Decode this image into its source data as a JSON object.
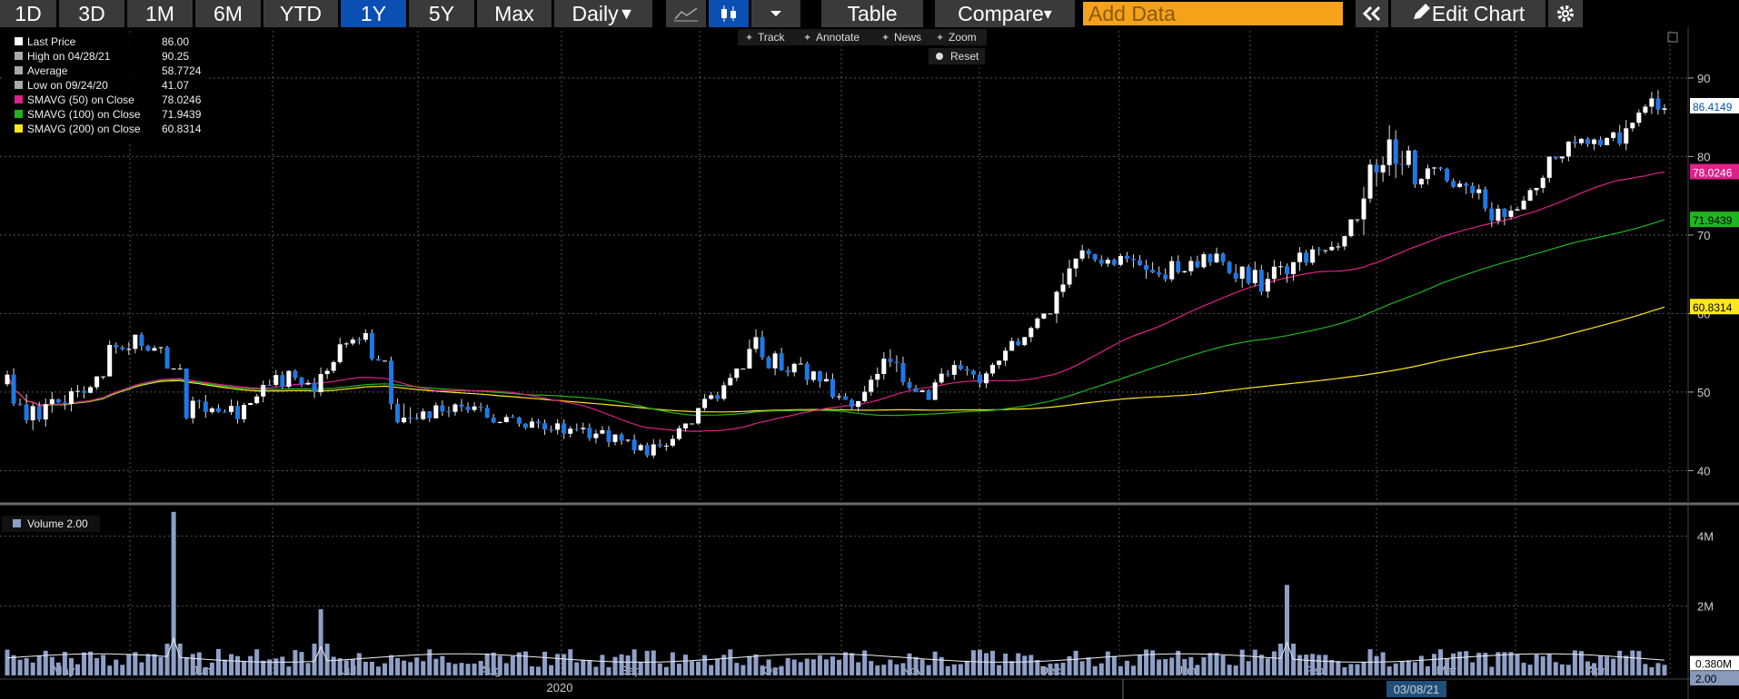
{
  "toolbar": {
    "ranges": [
      "1D",
      "3D",
      "1M",
      "6M",
      "YTD",
      "1Y",
      "5Y",
      "Max"
    ],
    "active_range": "1Y",
    "interval": "Daily",
    "table_label": "Table",
    "compare_label": "Compare",
    "add_data_placeholder": "Add Data",
    "edit_chart_label": "Edit Chart"
  },
  "chart_tools": {
    "track": "Track",
    "annotate": "Annotate",
    "news": "News",
    "zoom": "Zoom",
    "reset": "Reset"
  },
  "legend": [
    {
      "label": "Last Price",
      "value": "86.00",
      "color": "#ffffff"
    },
    {
      "label": "High on 04/28/21",
      "value": "90.25",
      "color": "#aaaaaa"
    },
    {
      "label": "Average",
      "value": "58.7724",
      "color": "#aaaaaa"
    },
    {
      "label": "Low on 09/24/20",
      "value": "41.07",
      "color": "#aaaaaa"
    },
    {
      "label": "SMAVG (50)  on Close",
      "value": "78.0246",
      "color": "#e0208a"
    },
    {
      "label": "SMAVG (100)  on Close",
      "value": "71.9439",
      "color": "#1fb51f"
    },
    {
      "label": "SMAVG (200)  on Close",
      "value": "60.8314",
      "color": "#ffe81a"
    }
  ],
  "volume_legend": "Volume 2.00",
  "price_tags": [
    {
      "value": "86.4149",
      "bg": "#ffffff",
      "fg": "#0055aa"
    },
    {
      "value": "78.0246",
      "bg": "#e0208a",
      "fg": "#ffffff"
    },
    {
      "value": "71.9439",
      "bg": "#1fb51f",
      "fg": "#000000"
    },
    {
      "value": "60.8314",
      "bg": "#ffe81a",
      "fg": "#000000"
    }
  ],
  "volume_tags": [
    {
      "value": "0.380M",
      "bg": "#ffffff",
      "fg": "#000000"
    },
    {
      "value": "2.00",
      "bg": "#8899bb",
      "fg": "#000000"
    }
  ],
  "crosshair_date": "03/08/21",
  "colors": {
    "up": "#ffffff",
    "down": "#1e78e6",
    "volume": "#8ea0c8",
    "grid": "#555555",
    "background": "#000000"
  },
  "chart_data": {
    "type": "candlestick",
    "interval": "Daily",
    "x_labels": [
      "May",
      "Jun",
      "Jul",
      "Aug",
      "Sep",
      "Oct",
      "Nov",
      "Dec",
      "Jan",
      "Feb",
      "Mar",
      "Apr"
    ],
    "year_label": "2020",
    "y_axis": {
      "ticks": [
        40,
        50,
        60,
        70,
        80,
        90
      ],
      "range": [
        36,
        96
      ]
    },
    "volume_axis": {
      "ticks": [
        "2M",
        "4M"
      ],
      "range": [
        0,
        4.8
      ]
    },
    "weekly_close": [
      51,
      47,
      50,
      49,
      55,
      57,
      55,
      48,
      49,
      47,
      51,
      52,
      51,
      56,
      57,
      48,
      47,
      48,
      48,
      47,
      46,
      46,
      45,
      45,
      44,
      42,
      44,
      48,
      51,
      56,
      54,
      53,
      51,
      48,
      53,
      52,
      50,
      53,
      51,
      55,
      58,
      63,
      68,
      67,
      66,
      65,
      66,
      67,
      66,
      64,
      66,
      68,
      69,
      76,
      80,
      78,
      78,
      76,
      73,
      73,
      78,
      81,
      82,
      82,
      86
    ],
    "weekly_high": [
      54,
      52,
      53,
      52,
      57,
      58,
      58,
      52,
      51,
      50,
      53,
      54,
      54,
      57,
      58,
      57,
      49,
      50,
      50,
      49,
      48,
      48,
      47,
      47,
      46,
      45,
      46,
      50,
      53,
      58,
      57,
      55,
      54,
      53,
      56,
      55,
      54,
      55,
      54,
      57,
      60,
      67,
      70,
      69,
      69,
      69,
      69,
      70,
      70,
      68,
      69,
      70,
      72,
      80,
      84,
      83,
      80,
      79,
      77,
      76,
      80,
      83,
      85,
      86,
      90.25
    ],
    "weekly_low": [
      46,
      45,
      47,
      47,
      52,
      54,
      53,
      46,
      46,
      46,
      48,
      50,
      49,
      52,
      54,
      46,
      45,
      46,
      46,
      45,
      44,
      44,
      43,
      43,
      42,
      41.07,
      43,
      45,
      48,
      51,
      52,
      50,
      49,
      47,
      49,
      50,
      49,
      51,
      50,
      52,
      56,
      58,
      66,
      65,
      62,
      63,
      64,
      65,
      63,
      62,
      62,
      66,
      68,
      68,
      72,
      76,
      76,
      73,
      71,
      72,
      74,
      78,
      80,
      80,
      84
    ],
    "sma_50_end": 78.0246,
    "sma_100_end": 71.9439,
    "sma_200_end": 60.8314,
    "volume_spikes": [
      {
        "month": "Jun",
        "value": 4.7
      },
      {
        "month": "Jul",
        "value": 1.9
      },
      {
        "month": "Feb",
        "value": 2.6
      }
    ],
    "volume_typical": 0.38
  }
}
